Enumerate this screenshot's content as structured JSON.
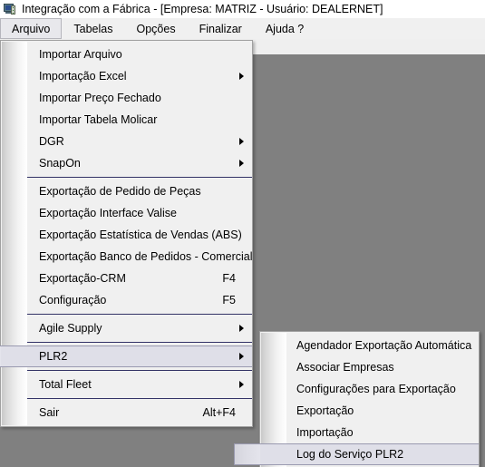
{
  "window": {
    "title": "Integração com a Fábrica - [Empresa: MATRIZ - Usuário: DEALERNET]",
    "icon": "computer-icon"
  },
  "menubar": {
    "items": [
      {
        "label": "Arquivo",
        "open": true
      },
      {
        "label": "Tabelas",
        "open": false
      },
      {
        "label": "Opções",
        "open": false
      },
      {
        "label": "Finalizar",
        "open": false
      },
      {
        "label": "Ajuda ?",
        "open": false
      }
    ]
  },
  "file_menu": {
    "items": [
      {
        "label": "Importar Arquivo",
        "accel": "",
        "submenu": false,
        "selected": false,
        "separator_before": false
      },
      {
        "label": "Importação Excel",
        "accel": "",
        "submenu": true,
        "selected": false,
        "separator_before": false
      },
      {
        "label": "Importar Preço Fechado",
        "accel": "",
        "submenu": false,
        "selected": false,
        "separator_before": false
      },
      {
        "label": "Importar Tabela Molicar",
        "accel": "",
        "submenu": false,
        "selected": false,
        "separator_before": false
      },
      {
        "label": "DGR",
        "accel": "",
        "submenu": true,
        "selected": false,
        "separator_before": false
      },
      {
        "label": "SnapOn",
        "accel": "",
        "submenu": true,
        "selected": false,
        "separator_before": false
      },
      {
        "label": "Exportação de Pedido de Peças",
        "accel": "",
        "submenu": false,
        "selected": false,
        "separator_before": true
      },
      {
        "label": "Exportação Interface Valise",
        "accel": "",
        "submenu": false,
        "selected": false,
        "separator_before": false
      },
      {
        "label": "Exportação Estatística de Vendas (ABS)",
        "accel": "",
        "submenu": false,
        "selected": false,
        "separator_before": false
      },
      {
        "label": "Exportação Banco de Pedidos - Comercial",
        "accel": "",
        "submenu": false,
        "selected": false,
        "separator_before": false
      },
      {
        "label": "Exportação-CRM",
        "accel": "F4",
        "submenu": false,
        "selected": false,
        "separator_before": false
      },
      {
        "label": "Configuração",
        "accel": "F5",
        "submenu": false,
        "selected": false,
        "separator_before": false
      },
      {
        "label": "Agile Supply",
        "accel": "",
        "submenu": true,
        "selected": false,
        "separator_before": true
      },
      {
        "label": "PLR2",
        "accel": "",
        "submenu": true,
        "selected": true,
        "separator_before": true
      },
      {
        "label": "Total Fleet",
        "accel": "",
        "submenu": true,
        "selected": false,
        "separator_before": true
      },
      {
        "label": "Sair",
        "accel": "Alt+F4",
        "submenu": false,
        "selected": false,
        "separator_before": true
      }
    ]
  },
  "plr2_menu": {
    "items": [
      {
        "label": "Agendador Exportação Automática",
        "accel": "",
        "submenu": false,
        "selected": false,
        "separator_before": false
      },
      {
        "label": "Associar Empresas",
        "accel": "",
        "submenu": false,
        "selected": false,
        "separator_before": false
      },
      {
        "label": "Configurações para Exportação",
        "accel": "",
        "submenu": false,
        "selected": false,
        "separator_before": false
      },
      {
        "label": "Exportação",
        "accel": "",
        "submenu": false,
        "selected": false,
        "separator_before": false
      },
      {
        "label": "Importação",
        "accel": "",
        "submenu": false,
        "selected": false,
        "separator_before": false
      },
      {
        "label": "Log do Serviço PLR2",
        "accel": "",
        "submenu": false,
        "selected": true,
        "separator_before": false
      }
    ]
  },
  "colors": {
    "titlebar_bg": "#ffffff",
    "menubar_bg": "#f0f0f0",
    "menu_bg": "#f0f0f0",
    "client_bg": "#808080",
    "separator": "#333366",
    "selection_bg": "#dfdfe8",
    "selection_border": "#9a9ab0"
  }
}
